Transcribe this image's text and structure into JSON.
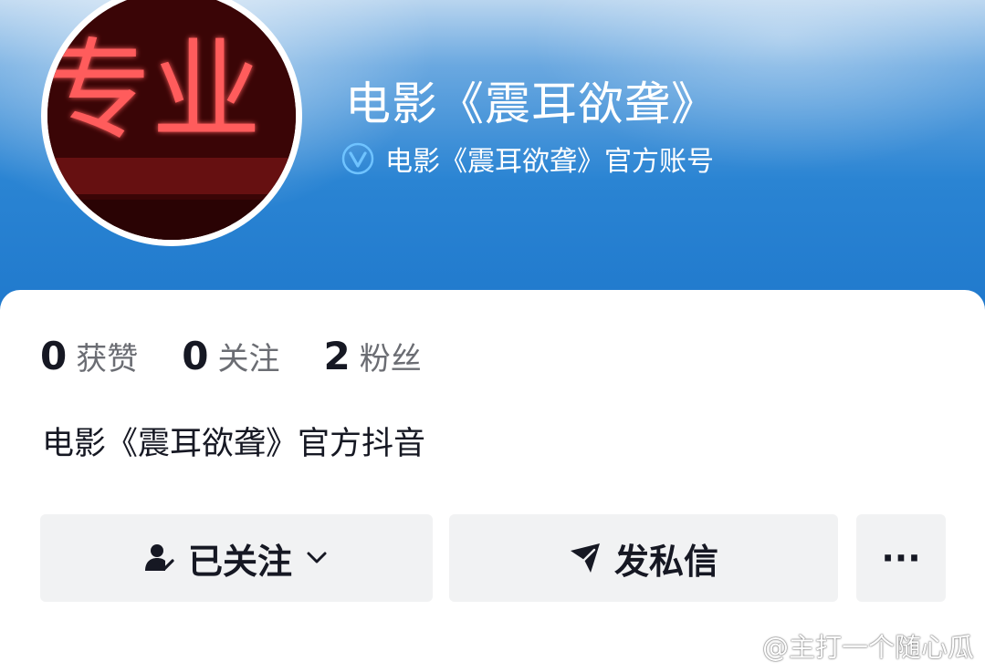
{
  "profile": {
    "name": "电影《震耳欲聋》",
    "verified_label": "电影《震耳欲聋》官方账号",
    "avatar_text": "专业",
    "bio": "电影《震耳欲聋》官方抖音"
  },
  "stats": [
    {
      "value": "0",
      "label": "获赞"
    },
    {
      "value": "0",
      "label": "关注"
    },
    {
      "value": "2",
      "label": "粉丝"
    }
  ],
  "actions": {
    "follow_label": "已关注",
    "message_label": "发私信",
    "more_label": "···"
  },
  "watermark": {
    "text": "@主打一个随心瓜"
  },
  "colors": {
    "banner_blue": "#1f78cc",
    "verified_blue": "#4aa7f0",
    "text_primary": "#161823",
    "text_secondary": "#6b6d73",
    "button_bg": "#f1f2f3"
  },
  "icons": {
    "verified": "verified-v-icon",
    "follow": "user-check-icon",
    "dropdown": "chevron-down-icon",
    "message": "send-icon",
    "more": "more-icon",
    "watermark": "weibo-icon"
  }
}
